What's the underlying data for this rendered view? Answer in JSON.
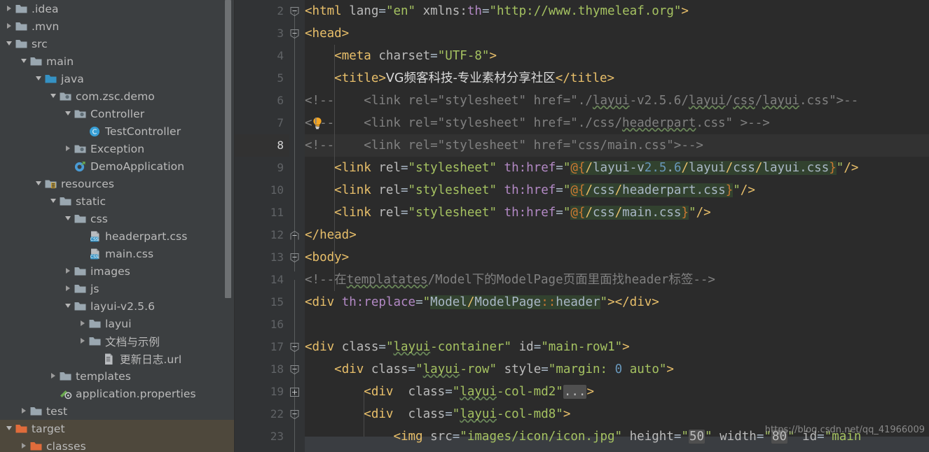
{
  "project_tree": {
    "items": [
      {
        "label": ".idea",
        "depth": 0,
        "arrow": "collapsed",
        "icon": "folder-gray",
        "excluded": false
      },
      {
        "label": ".mvn",
        "depth": 0,
        "arrow": "collapsed",
        "icon": "folder-gray",
        "excluded": false
      },
      {
        "label": "src",
        "depth": 0,
        "arrow": "expanded",
        "icon": "folder-gray",
        "excluded": false
      },
      {
        "label": "main",
        "depth": 1,
        "arrow": "expanded",
        "icon": "folder-gray",
        "excluded": false
      },
      {
        "label": "java",
        "depth": 2,
        "arrow": "expanded",
        "icon": "folder-blue",
        "excluded": false
      },
      {
        "label": "com.zsc.demo",
        "depth": 3,
        "arrow": "expanded",
        "icon": "folder-package",
        "excluded": false
      },
      {
        "label": "Controller",
        "depth": 4,
        "arrow": "expanded",
        "icon": "folder-package",
        "excluded": false
      },
      {
        "label": "TestController",
        "depth": 5,
        "arrow": "none",
        "icon": "class-icon",
        "excluded": false
      },
      {
        "label": "Exception",
        "depth": 4,
        "arrow": "collapsed",
        "icon": "folder-package",
        "excluded": false
      },
      {
        "label": "DemoApplication",
        "depth": 4,
        "arrow": "none",
        "icon": "spring-boot-icon",
        "excluded": false
      },
      {
        "label": "resources",
        "depth": 2,
        "arrow": "expanded",
        "icon": "folder-resources",
        "excluded": false
      },
      {
        "label": "static",
        "depth": 3,
        "arrow": "expanded",
        "icon": "folder-gray",
        "excluded": false
      },
      {
        "label": "css",
        "depth": 4,
        "arrow": "expanded",
        "icon": "folder-gray",
        "excluded": false
      },
      {
        "label": "headerpart.css",
        "depth": 5,
        "arrow": "none",
        "icon": "css-file-icon",
        "excluded": false
      },
      {
        "label": "main.css",
        "depth": 5,
        "arrow": "none",
        "icon": "css-file-icon",
        "excluded": false
      },
      {
        "label": "images",
        "depth": 4,
        "arrow": "collapsed",
        "icon": "folder-gray",
        "excluded": false
      },
      {
        "label": "js",
        "depth": 4,
        "arrow": "collapsed",
        "icon": "folder-gray",
        "excluded": false
      },
      {
        "label": "layui-v2.5.6",
        "depth": 4,
        "arrow": "expanded",
        "icon": "folder-gray",
        "excluded": false
      },
      {
        "label": "layui",
        "depth": 5,
        "arrow": "collapsed",
        "icon": "folder-gray",
        "excluded": false
      },
      {
        "label": "文档与示例",
        "depth": 5,
        "arrow": "collapsed",
        "icon": "folder-gray",
        "excluded": false
      },
      {
        "label": "更新日志.url",
        "depth": 6,
        "arrow": "none",
        "icon": "url-file-icon",
        "excluded": false
      },
      {
        "label": "templates",
        "depth": 3,
        "arrow": "collapsed",
        "icon": "folder-gray",
        "excluded": false
      },
      {
        "label": "application.properties",
        "depth": 3,
        "arrow": "none",
        "icon": "properties-icon",
        "excluded": false
      },
      {
        "label": "test",
        "depth": 1,
        "arrow": "collapsed",
        "icon": "folder-gray",
        "excluded": false
      },
      {
        "label": "target",
        "depth": 0,
        "arrow": "expanded",
        "icon": "folder-orange",
        "excluded": true
      },
      {
        "label": "classes",
        "depth": 1,
        "arrow": "collapsed",
        "icon": "folder-orange",
        "excluded": true
      }
    ]
  },
  "editor": {
    "current_line": 8,
    "line_numbers": [
      2,
      3,
      4,
      5,
      6,
      7,
      8,
      9,
      10,
      11,
      12,
      13,
      14,
      15,
      16,
      17,
      18,
      19,
      22,
      23
    ],
    "lines": [
      {
        "n": 2,
        "text": "<html lang=\"en\" xmlns:th=\"http://www.thymeleaf.org\">"
      },
      {
        "n": 3,
        "text": "<head>"
      },
      {
        "n": 4,
        "text": "    <meta charset=\"UTF-8\">"
      },
      {
        "n": 5,
        "text": "    <title>VG频客科技-专业素材分享社区</title>"
      },
      {
        "n": 6,
        "text": "<!--    <link rel=\"stylesheet\" href=\"./layui-v2.5.6/layui/css/layui.css\">--"
      },
      {
        "n": 7,
        "text": "<!--    <link rel=\"stylesheet\" href=\"./css/headerpart.css\" >-->"
      },
      {
        "n": 8,
        "text": "<!--    <link rel=\"stylesheet\" href=\"css/main.css\">-->"
      },
      {
        "n": 9,
        "text": "    <link rel=\"stylesheet\" th:href=\"@{/layui-v2.5.6/layui/css/layui.css}\"/>"
      },
      {
        "n": 10,
        "text": "    <link rel=\"stylesheet\" th:href=\"@{/css/headerpart.css}\"/>"
      },
      {
        "n": 11,
        "text": "    <link rel=\"stylesheet\" th:href=\"@{/css/main.css}\"/>"
      },
      {
        "n": 12,
        "text": "</head>"
      },
      {
        "n": 13,
        "text": "<body>"
      },
      {
        "n": 14,
        "text": "<!--在templatates/Model下的ModelPage页面里面找header标签-->"
      },
      {
        "n": 15,
        "text": "<div th:replace=\"Model/ModelPage::header\"></div>"
      },
      {
        "n": 16,
        "text": ""
      },
      {
        "n": 17,
        "text": "<div class=\"layui-container\" id=\"main-row1\">"
      },
      {
        "n": 18,
        "text": "    <div class=\"layui-row\" style=\"margin: 0 auto\">"
      },
      {
        "n": 19,
        "text": "        <div  class=\"layui-col-md2\"...>"
      },
      {
        "n": 22,
        "text": "        <div  class=\"layui-col-md8\">"
      },
      {
        "n": 23,
        "text": "            <img src=\"images/icon/icon.jpg\" height=\"50\" width=\"80\" id=\"main"
      }
    ],
    "folded_placeholder": "...",
    "lightbulb_line": 7
  },
  "watermark": {
    "text": "https://blog.csdn.net/qq_41966009"
  },
  "colors": {
    "panel_bg": "#3c3f41",
    "editor_bg": "#2b2b2b",
    "gutter_bg": "#313335",
    "current_line_bg": "#323232",
    "excluded_row_bg": "#4e483c",
    "tag": "#e8bf6a",
    "string": "#a5c261",
    "comment": "#808080",
    "thymeleaf_attr": "#b389c5",
    "number": "#6897bb",
    "expression_bg": "#32422f",
    "folder_orange": "#e06c3b",
    "folder_gray": "#9aa7b0",
    "folder_blue": "#3592c4"
  }
}
